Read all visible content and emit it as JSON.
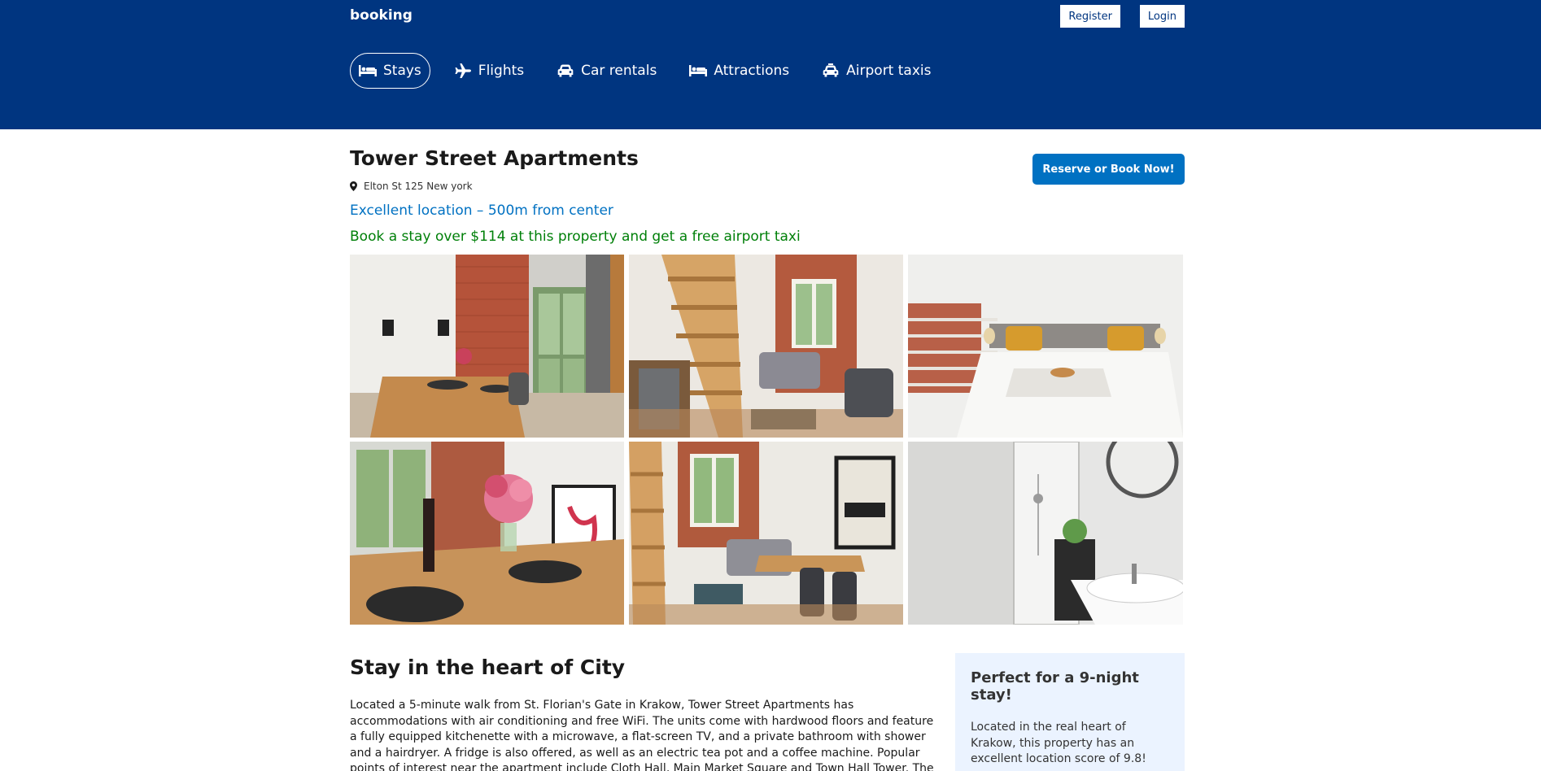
{
  "header": {
    "logo": "booking",
    "register_label": "Register",
    "login_label": "Login",
    "nav": [
      {
        "label": "Stays",
        "icon": "bed-icon",
        "active": true
      },
      {
        "label": "Flights",
        "icon": "plane-icon",
        "active": false
      },
      {
        "label": "Car rentals",
        "icon": "car-icon",
        "active": false
      },
      {
        "label": "Attractions",
        "icon": "bed-icon",
        "active": false
      },
      {
        "label": "Airport taxis",
        "icon": "taxi-icon",
        "active": false
      }
    ]
  },
  "property": {
    "title": "Tower Street Apartments",
    "address": "Elton St 125 New york",
    "location_note": "Excellent location – 500m from center",
    "taxi_offer": "Book a stay over $114 at this property and get a free airport taxi",
    "reserve_label": "Reserve or Book Now!"
  },
  "gallery": [
    {
      "subject": "dining area with brick wall and window"
    },
    {
      "subject": "living room with wooden staircase"
    },
    {
      "subject": "bedroom with double bed"
    },
    {
      "subject": "dining table with flowers and wine"
    },
    {
      "subject": "living room with POLSKA poster"
    },
    {
      "subject": "bathroom with shower and sink"
    }
  ],
  "details": {
    "heading": "Stay in the heart of City",
    "description": "Located a 5-minute walk from St. Florian's Gate in Krakow, Tower Street Apartments has accommodations with air conditioning and free WiFi. The units come with hardwood floors and feature a fully equipped kitchenette with a microwave, a flat-screen TV, and a private bathroom with shower and a hairdryer. A fridge is also offered, as well as an electric tea pot and a coffee machine. Popular points of interest near the apartment include Cloth Hall, Main Market Square and Town Hall Tower. The nearest airport is John Paul II International",
    "side_title": "Perfect for a 9-night stay!",
    "side_text": "Located in the real heart of Krakow, this property has an excellent location score of 9.8!"
  },
  "colors": {
    "header_bg": "#003580",
    "primary": "#0071c2",
    "offer_green": "#008009",
    "side_box_bg": "#ebf3ff"
  }
}
